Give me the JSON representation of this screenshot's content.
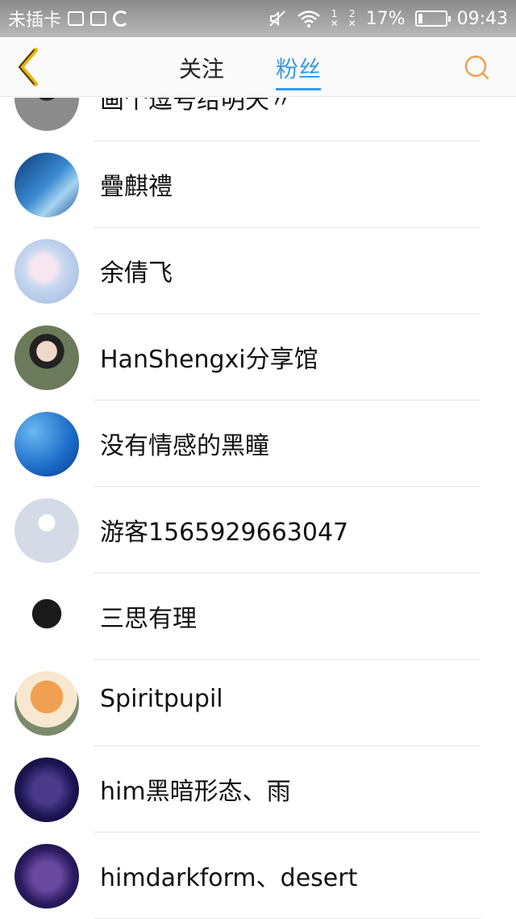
{
  "status_bar": {
    "carrier": "未插卡",
    "sim1": "1",
    "sim2": "2",
    "battery_percent": "17%",
    "battery_level": 0.17,
    "time": "09:43"
  },
  "header": {
    "back_icon": "chevron-left-icon",
    "tab_follow": "关注",
    "tab_fans": "粉丝",
    "active_tab": "粉丝",
    "search_icon": "search-icon",
    "accent_color": "#3b9be0",
    "icon_color": "#f0a04a"
  },
  "fans": [
    {
      "name": "画个逗号给明天〃"
    },
    {
      "name": "疊麒禮"
    },
    {
      "name": "余倩飞"
    },
    {
      "name": "HanShengxi分享馆"
    },
    {
      "name": "没有情感的黑瞳"
    },
    {
      "name": "游客1565929663047"
    },
    {
      "name": "三思有理"
    },
    {
      "name": "Spiritpupil"
    },
    {
      "name": "him黑暗形态、雨"
    },
    {
      "name": "himdarkform、desert"
    }
  ]
}
